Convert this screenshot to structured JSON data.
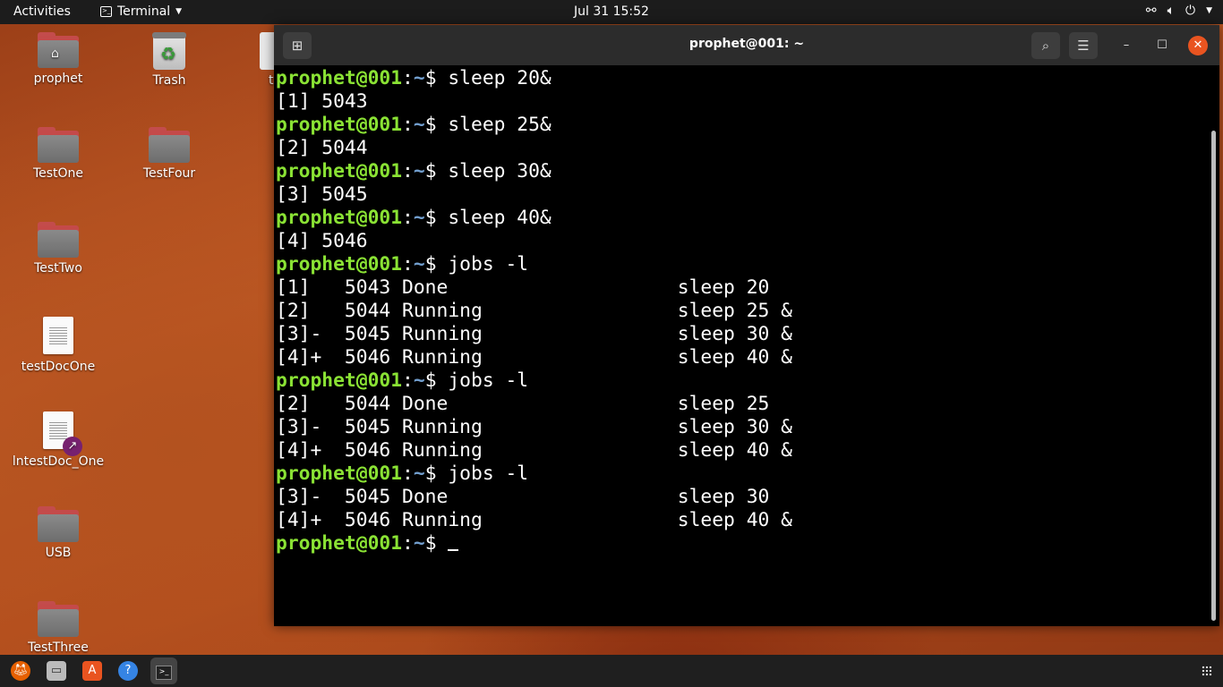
{
  "topbar": {
    "activities": "Activities",
    "app_name": "Terminal",
    "clock": "Jul 31  15:52",
    "tray_icons": [
      "network-icon",
      "volume-icon",
      "power-icon",
      "menu-caret-icon"
    ]
  },
  "desktop": {
    "icons": [
      {
        "label": "prophet",
        "type": "home-folder"
      },
      {
        "label": "Trash",
        "type": "trash"
      },
      {
        "label": "t",
        "type": "partially-hidden"
      },
      {
        "label": "TestOne",
        "type": "folder"
      },
      {
        "label": "TestFour",
        "type": "folder"
      },
      {
        "label": "TestTwo",
        "type": "folder"
      },
      {
        "label": "testDocOne",
        "type": "document"
      },
      {
        "label": "lntestDoc_One",
        "type": "document-link"
      },
      {
        "label": "USB",
        "type": "folder"
      },
      {
        "label": "TestThree",
        "type": "folder"
      }
    ]
  },
  "terminal": {
    "title": "prophet@001: ~",
    "prompt_user": "prophet@001",
    "prompt_sep": ":",
    "prompt_path": "~",
    "prompt_end": "$ ",
    "lines": [
      {
        "kind": "cmd",
        "text": "sleep 20&"
      },
      {
        "kind": "out",
        "text": "[1] 5043"
      },
      {
        "kind": "cmd",
        "text": "sleep 25&"
      },
      {
        "kind": "out",
        "text": "[2] 5044"
      },
      {
        "kind": "cmd",
        "text": "sleep 30&"
      },
      {
        "kind": "out",
        "text": "[3] 5045"
      },
      {
        "kind": "cmd",
        "text": "sleep 40&"
      },
      {
        "kind": "out",
        "text": "[4] 5046"
      },
      {
        "kind": "cmd",
        "text": "jobs -l"
      },
      {
        "kind": "out",
        "text": "[1]   5043 Done                    sleep 20"
      },
      {
        "kind": "out",
        "text": "[2]   5044 Running                 sleep 25 &"
      },
      {
        "kind": "out",
        "text": "[3]-  5045 Running                 sleep 30 &"
      },
      {
        "kind": "out",
        "text": "[4]+  5046 Running                 sleep 40 &"
      },
      {
        "kind": "cmd",
        "text": "jobs -l"
      },
      {
        "kind": "out",
        "text": "[2]   5044 Done                    sleep 25"
      },
      {
        "kind": "out",
        "text": "[3]-  5045 Running                 sleep 30 &"
      },
      {
        "kind": "out",
        "text": "[4]+  5046 Running                 sleep 40 &"
      },
      {
        "kind": "cmd",
        "text": "jobs -l"
      },
      {
        "kind": "out",
        "text": "[3]-  5045 Done                    sleep 30"
      },
      {
        "kind": "out",
        "text": "[4]+  5046 Running                 sleep 40 &"
      },
      {
        "kind": "prompt",
        "text": ""
      }
    ],
    "colors": {
      "prompt_user": "#8ae234",
      "prompt_path": "#729fcf",
      "background": "#000000",
      "close_button": "#e95420"
    }
  },
  "dock": {
    "apps": [
      "firefox-icon",
      "files-icon",
      "software-icon",
      "help-icon",
      "terminal-icon"
    ],
    "show_apps": "show-applications-icon"
  }
}
